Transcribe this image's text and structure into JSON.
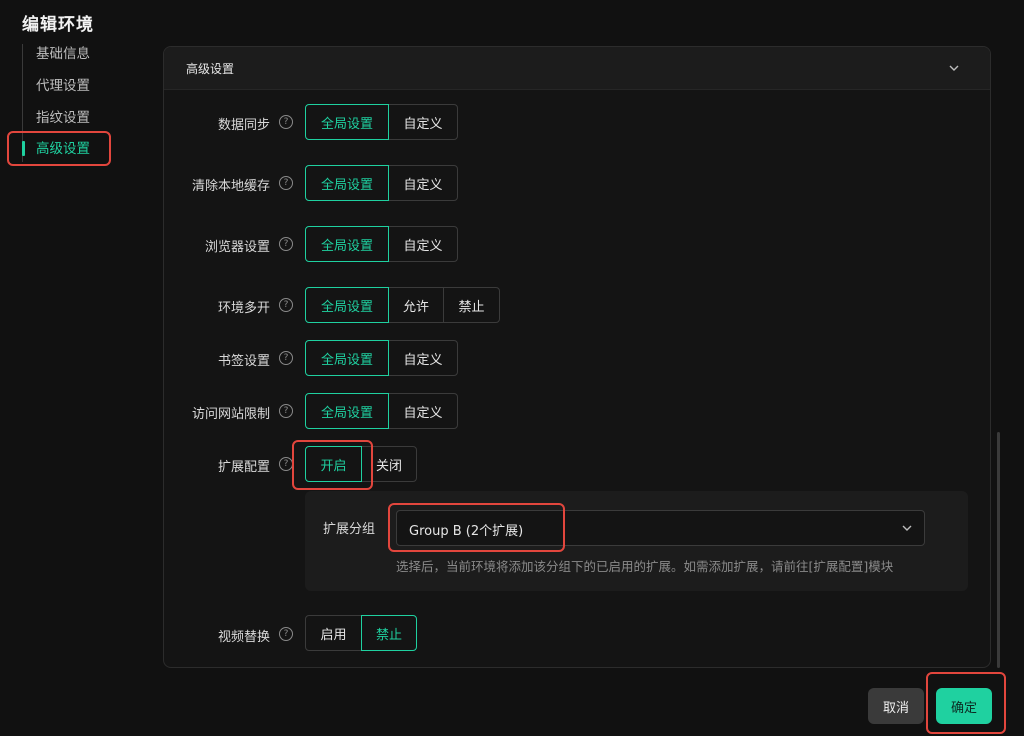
{
  "page": {
    "title": "编辑环境"
  },
  "nav": {
    "items": [
      {
        "label": "基础信息"
      },
      {
        "label": "代理设置"
      },
      {
        "label": "指纹设置"
      },
      {
        "label": "高级设置",
        "active": true
      }
    ]
  },
  "panel": {
    "title": "高级设置"
  },
  "help_glyph": "?",
  "settings": {
    "data_sync": {
      "label": "数据同步",
      "options": [
        "全局设置",
        "自定义"
      ],
      "selected": "全局设置"
    },
    "clear_cache": {
      "label": "清除本地缓存",
      "options": [
        "全局设置",
        "自定义"
      ],
      "selected": "全局设置"
    },
    "browser": {
      "label": "浏览器设置",
      "options": [
        "全局设置",
        "自定义"
      ],
      "selected": "全局设置"
    },
    "multi_open": {
      "label": "环境多开",
      "options": [
        "全局设置",
        "允许",
        "禁止"
      ],
      "selected": "全局设置"
    },
    "bookmarks": {
      "label": "书签设置",
      "options": [
        "全局设置",
        "自定义"
      ],
      "selected": "全局设置"
    },
    "site_limit": {
      "label": "访问网站限制",
      "options": [
        "全局设置",
        "自定义"
      ],
      "selected": "全局设置"
    },
    "extensions": {
      "label": "扩展配置",
      "options": [
        "开启",
        "关闭"
      ],
      "selected": "开启",
      "group_label": "扩展分组",
      "group_value": "Group B (2个扩展)",
      "hint": "选择后，当前环境将添加该分组下的已启用的扩展。如需添加扩展，请前往[扩展配置]模块"
    },
    "video": {
      "label": "视频替换",
      "options": [
        "启用",
        "禁止"
      ],
      "selected": "禁止"
    }
  },
  "footer": {
    "cancel": "取消",
    "confirm": "确定"
  },
  "colors": {
    "accent": "#1fd1a0",
    "highlight": "#e2463d",
    "background": "#111111"
  }
}
